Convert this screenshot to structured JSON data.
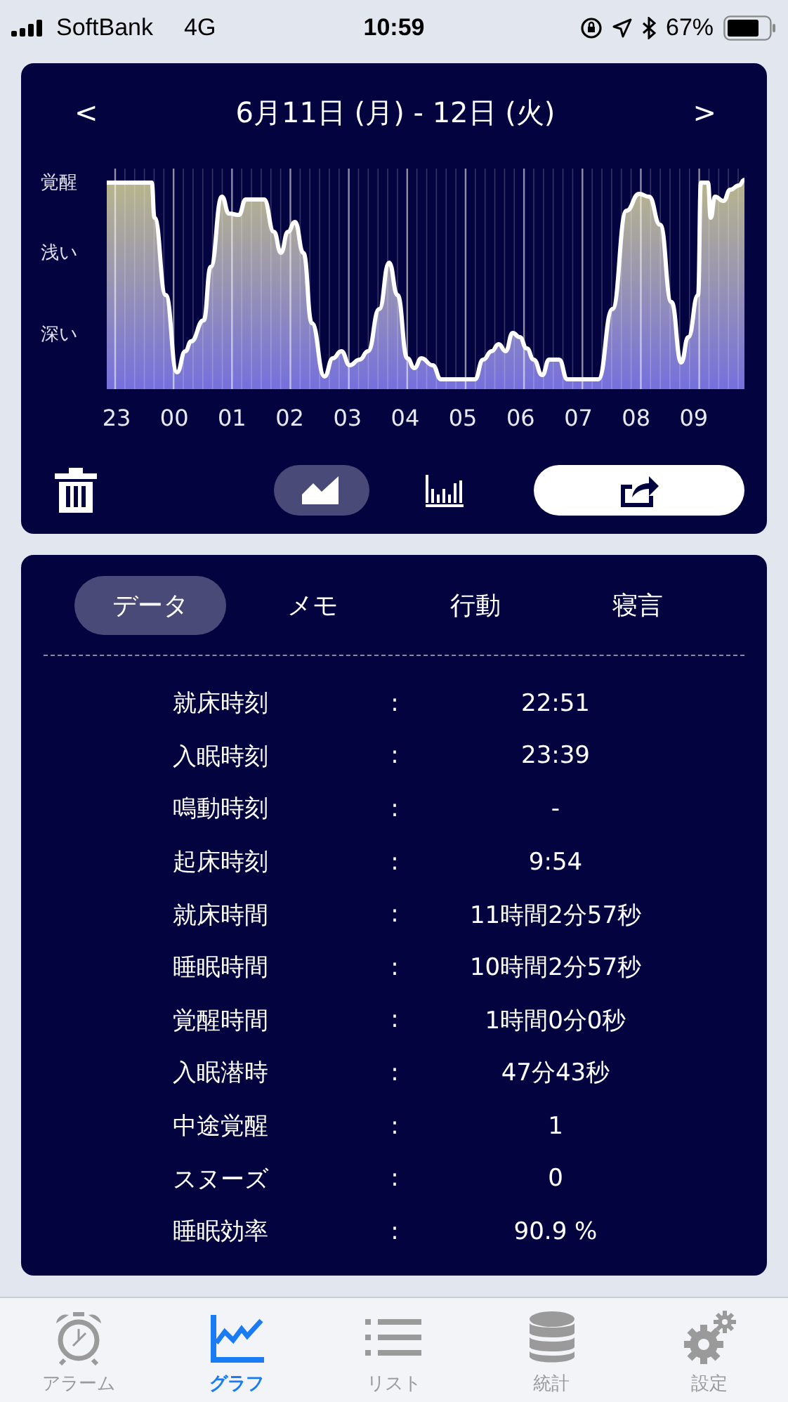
{
  "status_bar": {
    "carrier": "SoftBank",
    "network": "4G",
    "time": "10:59",
    "battery": "67%"
  },
  "graph": {
    "prev": "<",
    "title": "6月11日 (月) - 12日 (火)",
    "next": ">",
    "y_labels": [
      "覚醒",
      "浅い",
      "深い"
    ],
    "x_labels": [
      "23",
      "00",
      "01",
      "02",
      "03",
      "04",
      "05",
      "06",
      "07",
      "08",
      "09"
    ],
    "view_modes": [
      {
        "kind": "line",
        "selected": true
      },
      {
        "kind": "bar",
        "selected": false
      }
    ]
  },
  "data": {
    "tabs": [
      {
        "label": "データ",
        "selected": true
      },
      {
        "label": "メモ",
        "selected": false
      },
      {
        "label": "行動",
        "selected": false
      },
      {
        "label": "寝言",
        "selected": false
      }
    ],
    "separator": ":",
    "rows": [
      {
        "label": "就床時刻",
        "value": "22:51"
      },
      {
        "label": "入眠時刻",
        "value": "23:39"
      },
      {
        "label": "鳴動時刻",
        "value": "-"
      },
      {
        "label": "起床時刻",
        "value": "9:54"
      },
      {
        "label": "就床時間",
        "value": "11時間2分57秒"
      },
      {
        "label": "睡眠時間",
        "value": "10時間2分57秒"
      },
      {
        "label": "覚醒時間",
        "value": "1時間0分0秒"
      },
      {
        "label": "入眠潜時",
        "value": "47分43秒"
      },
      {
        "label": "中途覚醒",
        "value": "1"
      },
      {
        "label": "スヌーズ",
        "value": "0"
      },
      {
        "label": "睡眠効率",
        "value": "90.9 %"
      }
    ]
  },
  "tab_bar": [
    {
      "kind": "alarm",
      "label": "アラーム",
      "selected": false
    },
    {
      "kind": "graph",
      "label": "グラフ",
      "selected": true
    },
    {
      "kind": "list",
      "label": "リスト",
      "selected": false
    },
    {
      "kind": "stats",
      "label": "統計",
      "selected": false
    },
    {
      "kind": "settings",
      "label": "設定",
      "selected": false
    }
  ]
}
